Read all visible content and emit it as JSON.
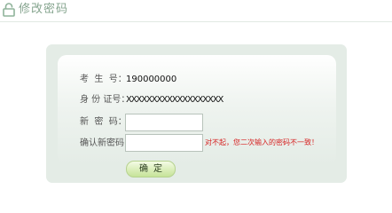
{
  "header": {
    "title": "修改密码",
    "icon": "lock-icon",
    "accent_color": "#86a58f"
  },
  "form": {
    "candidate_label": "考  生  号：",
    "candidate_value": "190000000",
    "id_label": "身 份 证号：",
    "id_value": "XXXXXXXXXXXXXXXXXXX",
    "new_password_label": "新  密  码：",
    "new_password_value": "",
    "confirm_password_label": "确认新密码：",
    "confirm_password_value": "",
    "error_message": "对不起，您二次输入的密码不一致！",
    "error_color": "#d61f1f",
    "submit_label": "确定"
  }
}
